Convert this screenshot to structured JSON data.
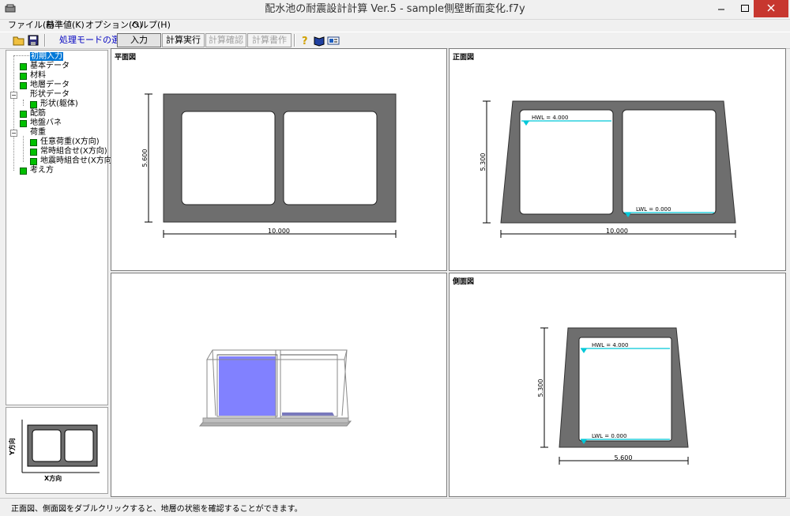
{
  "window": {
    "title": "配水池の耐震設計計算 Ver.5 - sample側壁断面変化.f7y"
  },
  "menu": [
    "ファイル(F)",
    "基準値(K)",
    "オプション(O)",
    "ヘルプ(H)"
  ],
  "toolbar": {
    "mode_label": "処理モードの選択",
    "buttons": [
      "入力",
      "計算実行",
      "計算確認",
      "計算書作成"
    ]
  },
  "tree": {
    "items": [
      {
        "label": "初期入力"
      },
      {
        "label": "基本データ"
      },
      {
        "label": "材料"
      },
      {
        "label": "地層データ"
      },
      {
        "label": "形状データ"
      },
      {
        "label": "形状(躯体)"
      },
      {
        "label": "配筋"
      },
      {
        "label": "地盤バネ"
      },
      {
        "label": "荷重"
      },
      {
        "label": "任意荷重(X方向)"
      },
      {
        "label": "常時組合せ(X方向)"
      },
      {
        "label": "地震時組合せ(X方向)"
      },
      {
        "label": "考え方"
      }
    ]
  },
  "minimap": {
    "x_label": "X方向",
    "y_label": "Y方向"
  },
  "panels": {
    "plan": {
      "title": "平面図",
      "dim_width": "10.000",
      "dim_height": "5.600"
    },
    "front": {
      "title": "正面図",
      "dim_width": "10.000",
      "dim_height": "5.300",
      "hwl": "HWL = 4.000",
      "lwl": "LWL = 0.000"
    },
    "side": {
      "title": "側面図",
      "dim_width": "5.600",
      "dim_height": "5.300",
      "hwl": "HWL = 4.000",
      "lwl": "LWL = 0.000"
    }
  },
  "status": {
    "text": "正面図、側面図をダブルクリックすると、地層の状態を確認することができます。"
  },
  "colors": {
    "concrete": "#6e6e6e",
    "water_line": "#00c8d8",
    "water_fill": "#6b6bff",
    "node": "#00c000",
    "selection": "#0078d7"
  }
}
